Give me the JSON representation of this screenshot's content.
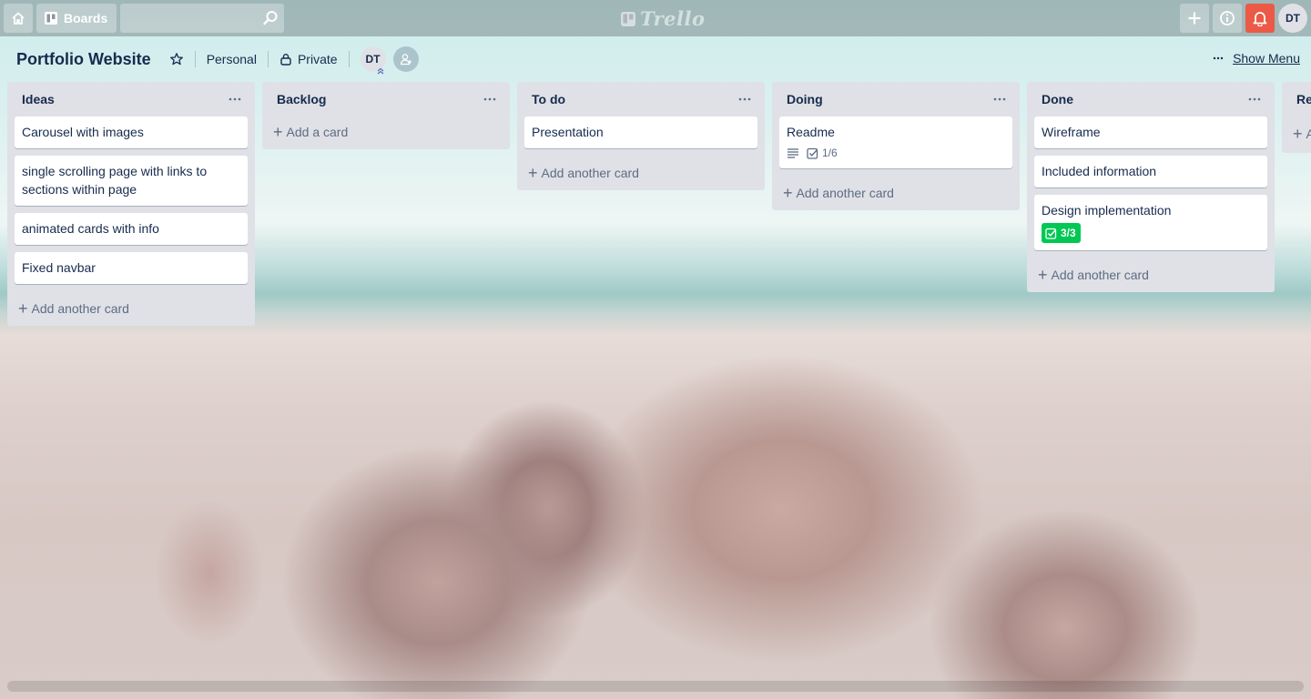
{
  "topbar": {
    "boards_label": "Boards",
    "search_value": "",
    "logo_text": "Trello",
    "avatar_initials": "DT"
  },
  "board": {
    "title": "Portfolio Website",
    "team": "Personal",
    "visibility": "Private",
    "member_initials": "DT",
    "show_menu_label": "Show Menu"
  },
  "lists": [
    {
      "title": "Ideas",
      "cards": [
        {
          "title": "Carousel with images"
        },
        {
          "title": "single scrolling page with links to sections within page"
        },
        {
          "title": "animated cards with info"
        },
        {
          "title": "Fixed navbar"
        }
      ],
      "add_label": "Add another card"
    },
    {
      "title": "Backlog",
      "cards": [],
      "add_label": "Add a card"
    },
    {
      "title": "To do",
      "cards": [
        {
          "title": "Presentation"
        }
      ],
      "add_label": "Add another card"
    },
    {
      "title": "Doing",
      "cards": [
        {
          "title": "Readme",
          "checklist": "1/6",
          "has_description": true
        }
      ],
      "add_label": "Add another card"
    },
    {
      "title": "Done",
      "cards": [
        {
          "title": "Wireframe"
        },
        {
          "title": "Included information"
        },
        {
          "title": "Design implementation",
          "checklist": "3/3",
          "checklist_complete": true
        }
      ],
      "add_label": "Add another card"
    },
    {
      "title": "Re",
      "cards": [],
      "add_label": "A"
    }
  ],
  "colors": {
    "list_bg": "#dfe1e6",
    "notification": "#eb5a46",
    "checklist_complete": "#00c853",
    "text": "#172b4d"
  }
}
